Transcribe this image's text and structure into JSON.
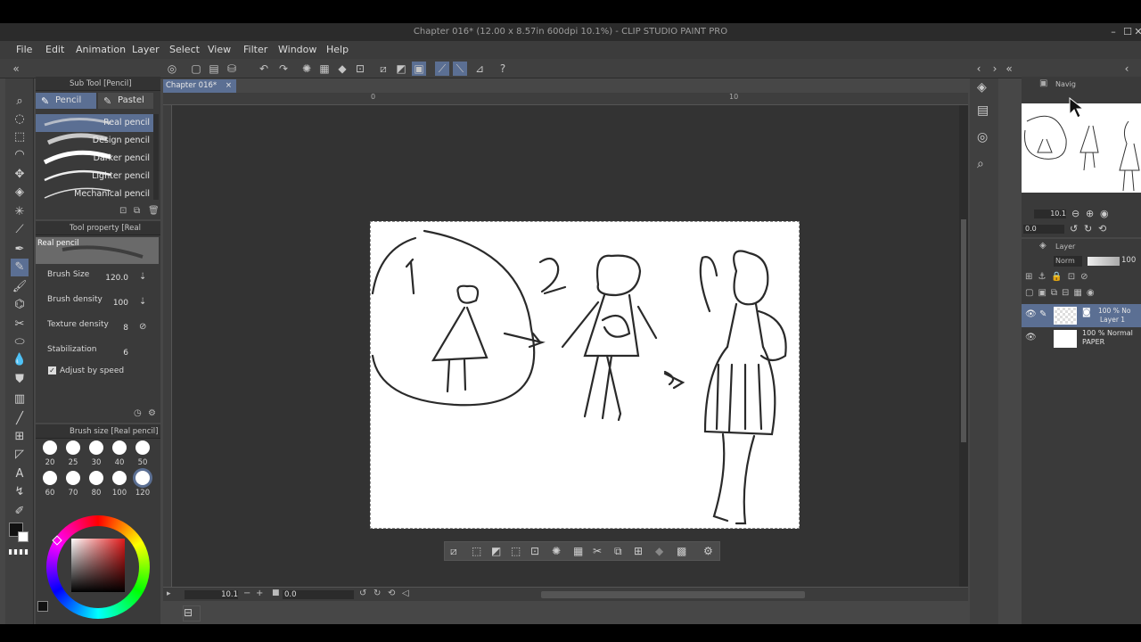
{
  "window": {
    "title": "Chapter 016* (12.00 x 8.57in 600dpi 10.1%) - CLIP STUDIO PAINT PRO"
  },
  "menu": [
    "File",
    "Edit",
    "Animation",
    "Layer",
    "Select",
    "View",
    "Filter",
    "Window",
    "Help"
  ],
  "canvas_tab": {
    "label": "Chapter 016*"
  },
  "ruler": {
    "mark_0": "0",
    "mark_10": "10"
  },
  "subtool": {
    "title": "Sub Tool [Pencil]",
    "tabs": [
      "Pencil",
      "Pastel"
    ],
    "brushes": [
      "Real pencil",
      "Design pencil",
      "Darker pencil",
      "Lighter pencil",
      "Mechanical pencil"
    ]
  },
  "tool_property": {
    "title": "Tool property [Real pencil]",
    "preview_label": "Real pencil",
    "brush_size_label": "Brush Size",
    "brush_size_value": "120.0",
    "brush_density_label": "Brush density",
    "brush_density_value": "100",
    "texture_density_label": "Texture density",
    "texture_density_value": "8",
    "stabilization_label": "Stabilization",
    "stabilization_value": "6",
    "adjust_speed_label": "Adjust by speed"
  },
  "brush_size_panel": {
    "title": "Brush size [Real pencil]",
    "sizes": [
      "20",
      "25",
      "30",
      "40",
      "50",
      "60",
      "70",
      "80",
      "100",
      "120"
    ]
  },
  "navigator": {
    "tab_label": "Navig",
    "zoom": "10.1",
    "angle": "0.0"
  },
  "layer_panel": {
    "tab_label": "Layer",
    "blend_mode": "Norm",
    "opacity": "100",
    "layers": [
      {
        "opacity_mode": "100 % No",
        "name": "Layer 1"
      },
      {
        "opacity_mode": "100 % Normal",
        "name": "PAPER"
      }
    ]
  },
  "status": {
    "zoom": "10.1",
    "angle": "0.0"
  },
  "colors": {
    "accent": "#5b6f93",
    "bg": "#474747",
    "canvas": "#333333"
  }
}
